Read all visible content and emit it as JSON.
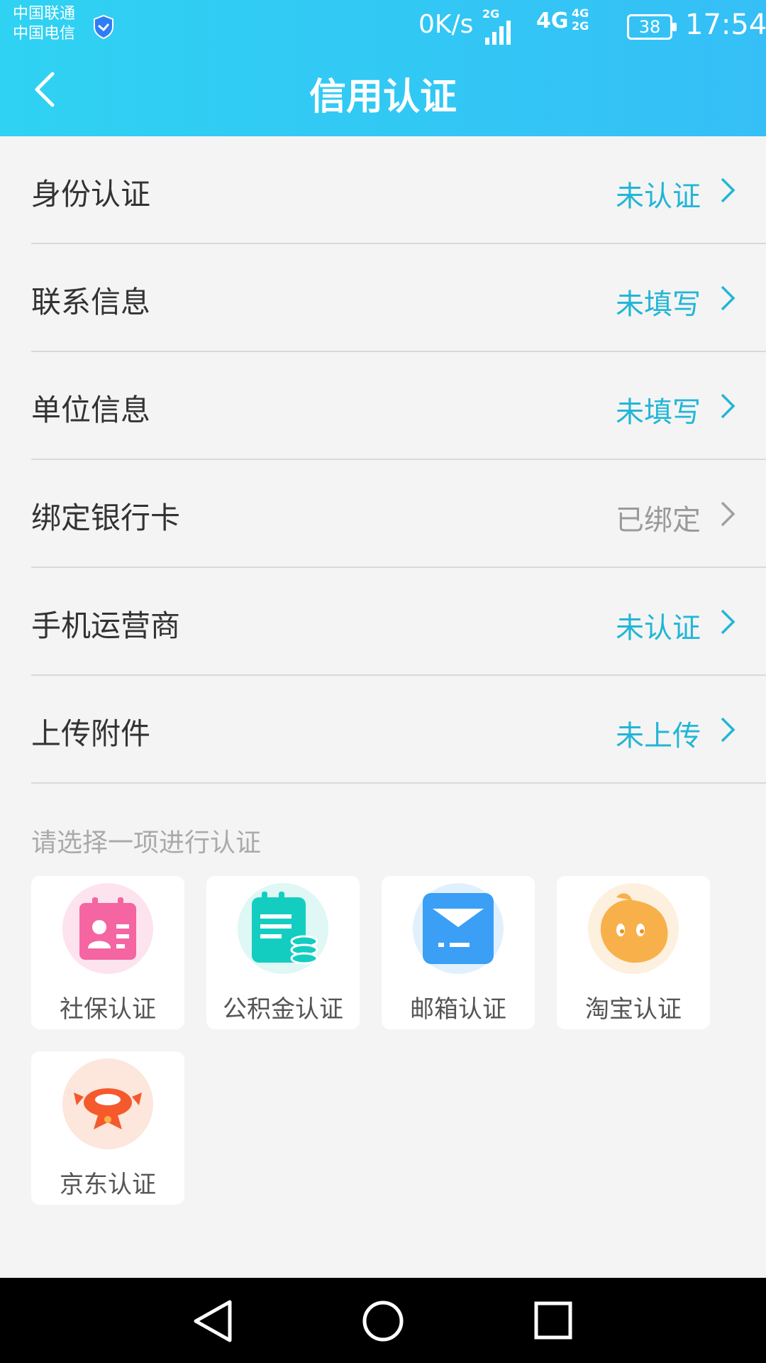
{
  "status_bar": {
    "carrier1": "中国联通",
    "carrier2": "中国电信",
    "speed": "0K/s",
    "net_a": "2G",
    "net_b": "4G",
    "net_c1": "4G",
    "net_c2": "2G",
    "battery": "38",
    "time": "17:54"
  },
  "header": {
    "title": "信用认证"
  },
  "colors": {
    "accent": "#22b6d6",
    "header_start": "#2fd2f2",
    "header_end": "#35bff6"
  },
  "rows": [
    {
      "label": "身份认证",
      "status": "未认证"
    },
    {
      "label": "联系信息",
      "status": "未填写"
    },
    {
      "label": "单位信息",
      "status": "未填写"
    },
    {
      "label": "绑定银行卡",
      "status": "已绑定"
    },
    {
      "label": "手机运营商",
      "status": "未认证"
    },
    {
      "label": "上传附件",
      "status": "未上传"
    }
  ],
  "section": {
    "title": "请选择一项进行认证"
  },
  "cards": [
    {
      "label": "社保认证",
      "icon": "social-security-icon"
    },
    {
      "label": "公积金认证",
      "icon": "housing-fund-icon"
    },
    {
      "label": "邮箱认证",
      "icon": "email-icon"
    },
    {
      "label": "淘宝认证",
      "icon": "taobao-icon"
    },
    {
      "label": "京东认证",
      "icon": "jd-icon"
    }
  ]
}
